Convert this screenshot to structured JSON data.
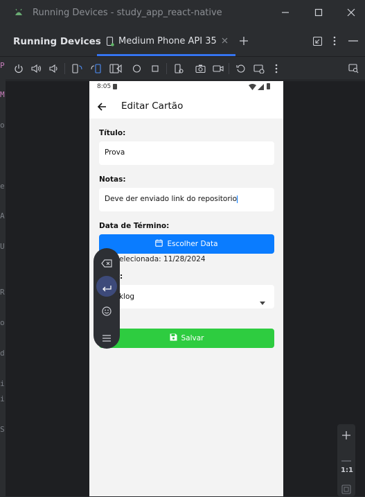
{
  "window": {
    "title": "Running Devices - study_app_react-native"
  },
  "tabbar": {
    "panel_title": "Running Devices",
    "device_tab": "Medium Phone API 35"
  },
  "zoom": {
    "reset_label": "1:1"
  },
  "phone": {
    "status_time": "8:05",
    "appbar_title": "Editar Cartão",
    "titulo_label": "Título:",
    "titulo_value": "Prova",
    "notas_label": "Notas:",
    "notas_value": "Deve der enviado link do repositorio",
    "data_label": "Data de Término:",
    "date_button": "Escolher Data",
    "selected_date": "elecionada: 11/28/2024",
    "status_label_partial": ":",
    "status_value_partial": "klog",
    "save_button": "Salvar"
  },
  "gutter_marks": [
    "P",
    "M",
    "o",
    "e",
    "A",
    "U",
    "R",
    "o",
    "d",
    "i",
    "i",
    "S"
  ],
  "colors": {
    "primary": "#0a7cff",
    "success": "#2ecc40",
    "ide_bg": "#2b2d30",
    "accent_tab": "#3574f0"
  }
}
